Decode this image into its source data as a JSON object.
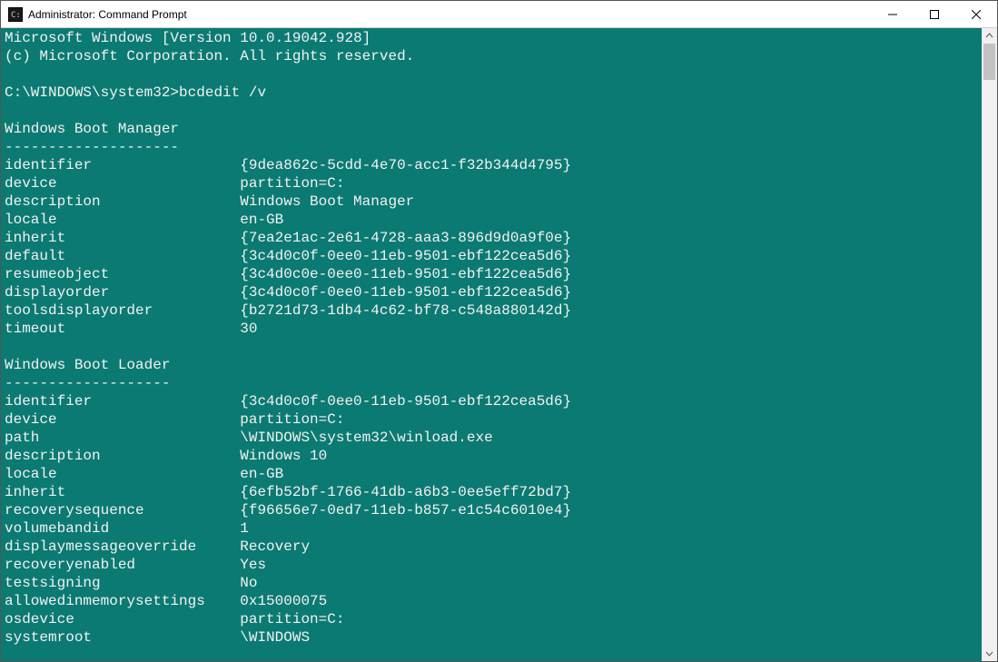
{
  "window": {
    "title": "Administrator: Command Prompt"
  },
  "terminal": {
    "header_line1": "Microsoft Windows [Version 10.0.19042.928]",
    "header_line2": "(c) Microsoft Corporation. All rights reserved.",
    "prompt_path": "C:\\WINDOWS\\system32>",
    "command": "bcdedit /v",
    "sections": [
      {
        "title": "Windows Boot Manager",
        "rule": "--------------------",
        "rows": [
          {
            "k": "identifier",
            "v": "{9dea862c-5cdd-4e70-acc1-f32b344d4795}"
          },
          {
            "k": "device",
            "v": "partition=C:"
          },
          {
            "k": "description",
            "v": "Windows Boot Manager"
          },
          {
            "k": "locale",
            "v": "en-GB"
          },
          {
            "k": "inherit",
            "v": "{7ea2e1ac-2e61-4728-aaa3-896d9d0a9f0e}"
          },
          {
            "k": "default",
            "v": "{3c4d0c0f-0ee0-11eb-9501-ebf122cea5d6}"
          },
          {
            "k": "resumeobject",
            "v": "{3c4d0c0e-0ee0-11eb-9501-ebf122cea5d6}"
          },
          {
            "k": "displayorder",
            "v": "{3c4d0c0f-0ee0-11eb-9501-ebf122cea5d6}"
          },
          {
            "k": "toolsdisplayorder",
            "v": "{b2721d73-1db4-4c62-bf78-c548a880142d}"
          },
          {
            "k": "timeout",
            "v": "30"
          }
        ]
      },
      {
        "title": "Windows Boot Loader",
        "rule": "-------------------",
        "rows": [
          {
            "k": "identifier",
            "v": "{3c4d0c0f-0ee0-11eb-9501-ebf122cea5d6}"
          },
          {
            "k": "device",
            "v": "partition=C:"
          },
          {
            "k": "path",
            "v": "\\WINDOWS\\system32\\winload.exe"
          },
          {
            "k": "description",
            "v": "Windows 10"
          },
          {
            "k": "locale",
            "v": "en-GB"
          },
          {
            "k": "inherit",
            "v": "{6efb52bf-1766-41db-a6b3-0ee5eff72bd7}"
          },
          {
            "k": "recoverysequence",
            "v": "{f96656e7-0ed7-11eb-b857-e1c54c6010e4}"
          },
          {
            "k": "volumebandid",
            "v": "1"
          },
          {
            "k": "displaymessageoverride",
            "v": "Recovery"
          },
          {
            "k": "recoveryenabled",
            "v": "Yes"
          },
          {
            "k": "testsigning",
            "v": "No"
          },
          {
            "k": "allowedinmemorysettings",
            "v": "0x15000075"
          },
          {
            "k": "osdevice",
            "v": "partition=C:"
          },
          {
            "k": "systemroot",
            "v": "\\WINDOWS"
          }
        ]
      }
    ]
  }
}
